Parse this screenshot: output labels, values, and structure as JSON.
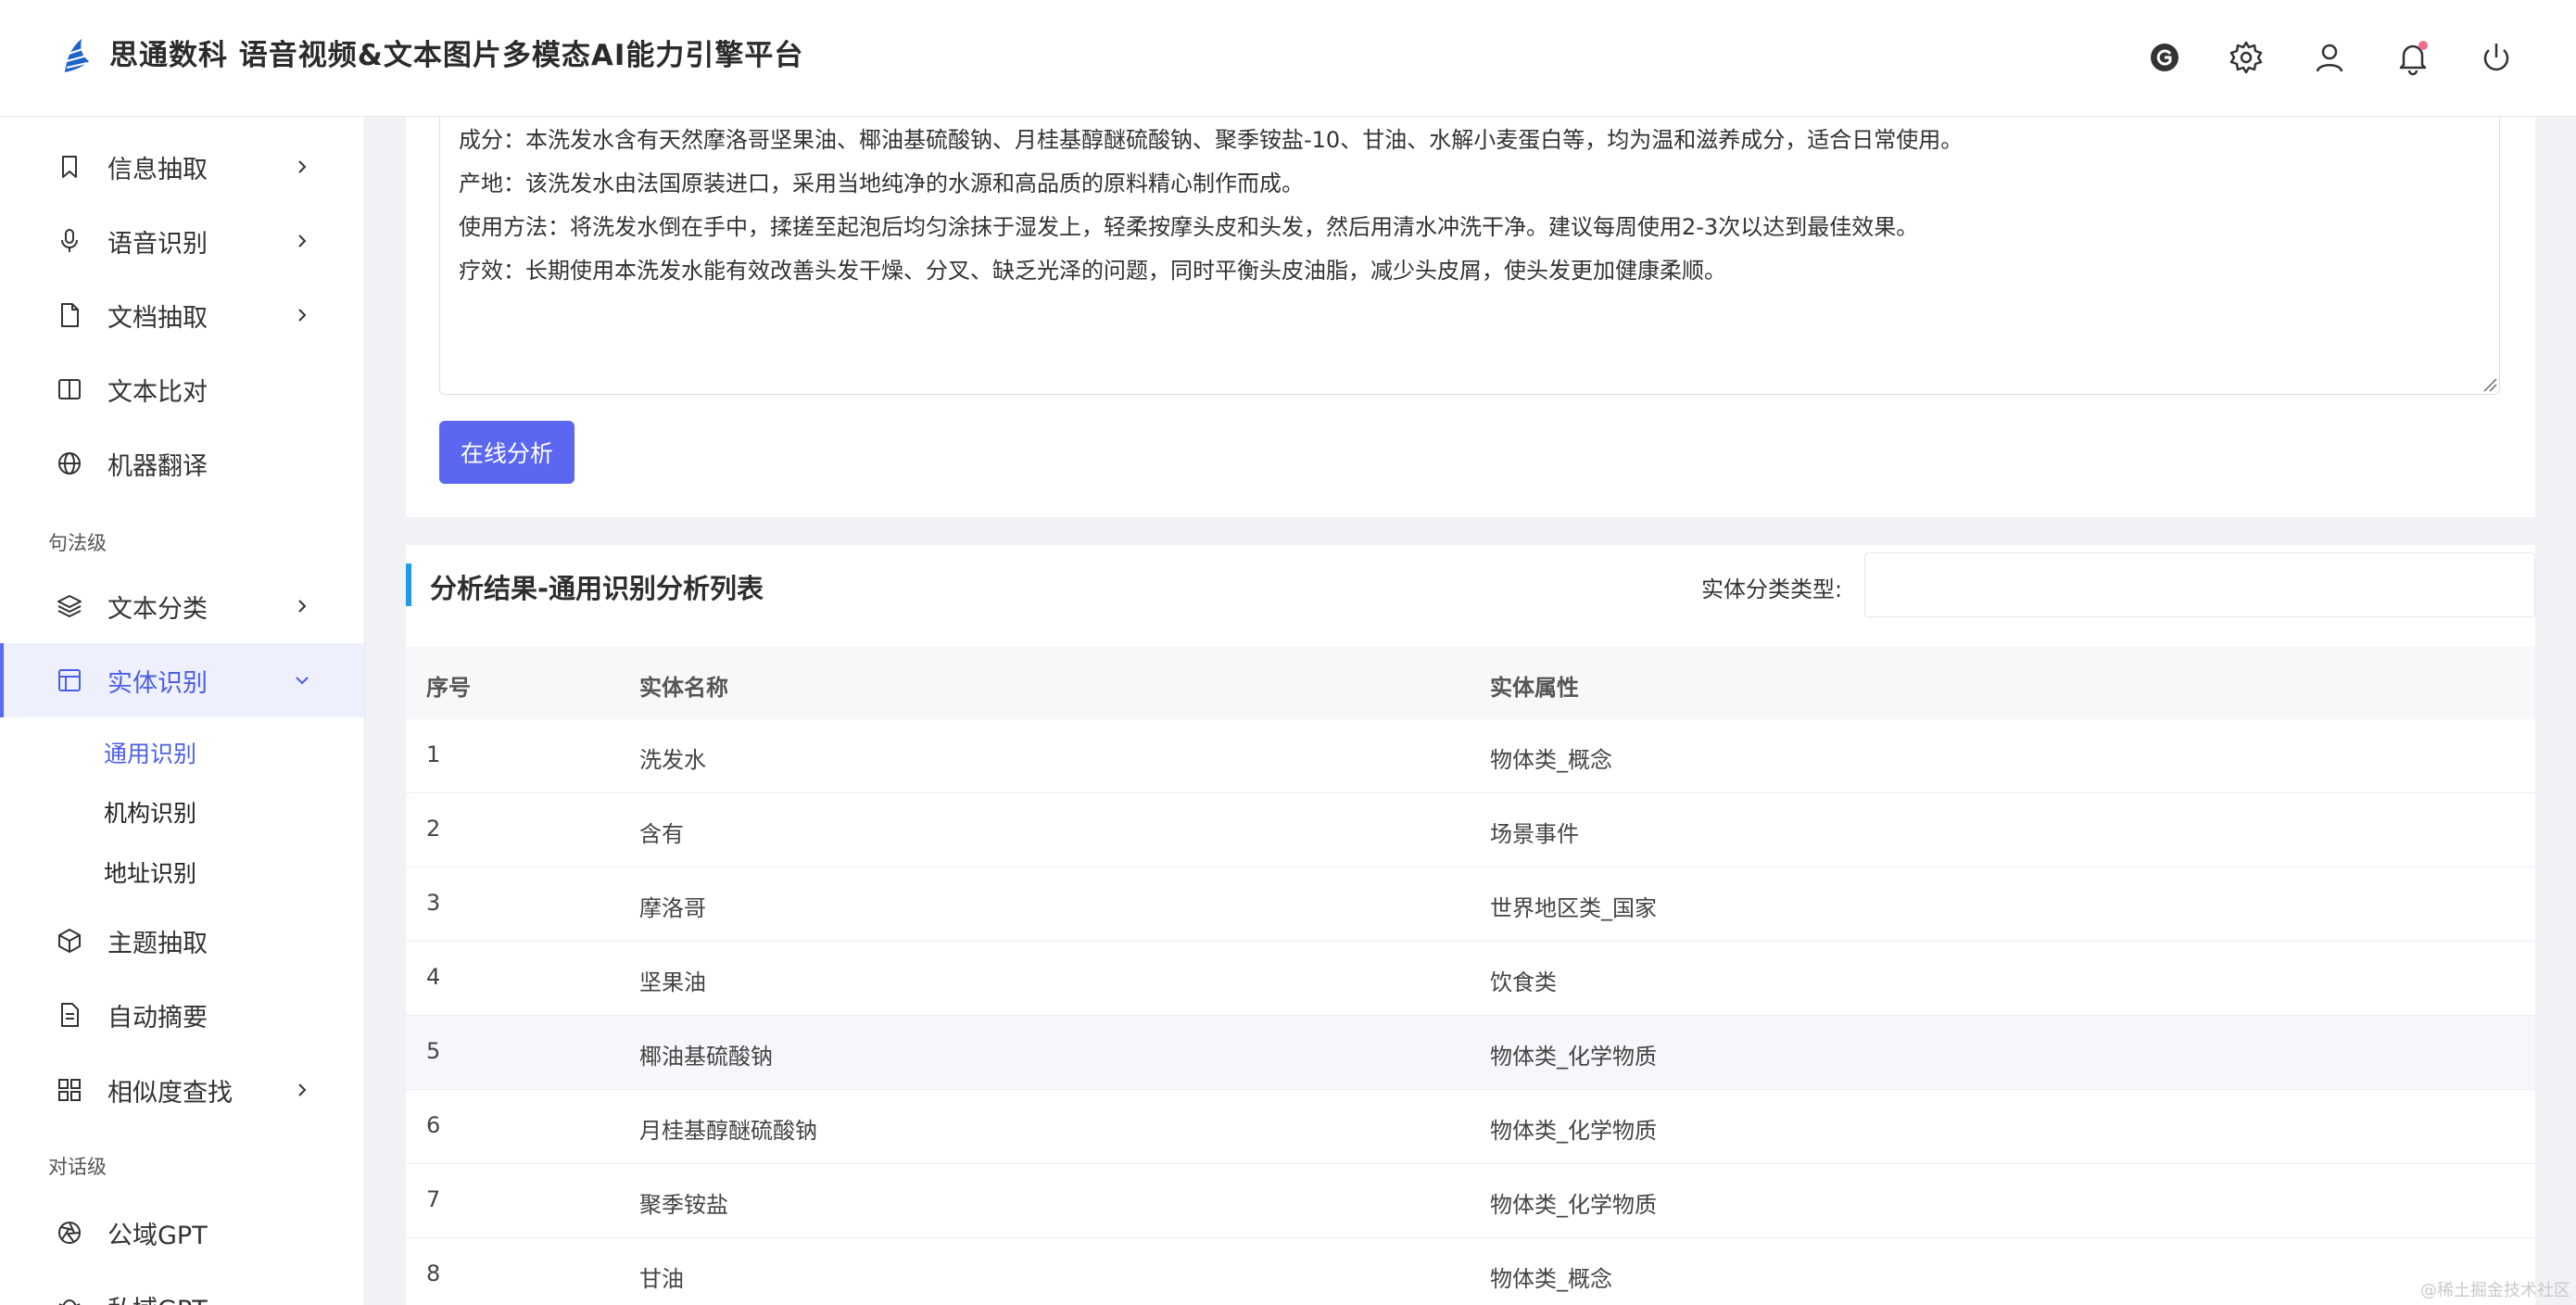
{
  "header": {
    "title": "思通数科 语音视频&文本图片多模态AI能力引擎平台",
    "icons": [
      "github-icon",
      "gear-icon",
      "user-icon",
      "bell-icon",
      "power-icon"
    ]
  },
  "sidebar": {
    "items": [
      {
        "label": "信息抽取",
        "icon": "bookmark-icon",
        "expandable": true
      },
      {
        "label": "语音识别",
        "icon": "microphone-icon",
        "expandable": true
      },
      {
        "label": "文档抽取",
        "icon": "document-icon",
        "expandable": true
      },
      {
        "label": "文本比对",
        "icon": "columns-icon",
        "expandable": false
      },
      {
        "label": "机器翻译",
        "icon": "globe-icon",
        "expandable": false
      },
      {
        "label": "文本分类",
        "icon": "layers-icon",
        "expandable": true
      },
      {
        "label": "实体识别",
        "icon": "layout-icon",
        "expandable": true,
        "active": true,
        "expanded": true
      },
      {
        "label": "主题抽取",
        "icon": "cube-icon",
        "expandable": false
      },
      {
        "label": "自动摘要",
        "icon": "file-text-icon",
        "expandable": false
      },
      {
        "label": "相似度查找",
        "icon": "grid-icon",
        "expandable": true
      },
      {
        "label": "公域GPT",
        "icon": "aperture-icon",
        "expandable": false
      },
      {
        "label": "私域GPT",
        "icon": "bug-icon",
        "expandable": false
      }
    ],
    "sections": [
      "句法级",
      "对话级"
    ],
    "subitems": [
      {
        "label": "通用识别",
        "active": true
      },
      {
        "label": "机构识别"
      },
      {
        "label": "地址识别"
      }
    ]
  },
  "input": {
    "lines": [
      "成分：本洗发水含有天然摩洛哥坚果油、椰油基硫酸钠、月桂基醇醚硫酸钠、聚季铵盐-10、甘油、水解小麦蛋白等，均为温和滋养成分，适合日常使用。",
      "产地：该洗发水由法国原装进口，采用当地纯净的水源和高品质的原料精心制作而成。",
      "使用方法：将洗发水倒在手中，揉搓至起泡后均匀涂抹于湿发上，轻柔按摩头皮和头发，然后用清水冲洗干净。建议每周使用2-3次以达到最佳效果。",
      "疗效：长期使用本洗发水能有效改善头发干燥、分叉、缺乏光泽的问题，同时平衡头皮油脂，减少头皮屑，使头发更加健康柔顺。"
    ],
    "analyze_button": "在线分析"
  },
  "results": {
    "title": "分析结果-通用识别分析列表",
    "filter_label": "实体分类类型:",
    "filter_value": "",
    "columns": [
      "序号",
      "实体名称",
      "实体属性"
    ],
    "rows": [
      [
        "1",
        "洗发水",
        "物体类_概念"
      ],
      [
        "2",
        "含有",
        "场景事件"
      ],
      [
        "3",
        "摩洛哥",
        "世界地区类_国家"
      ],
      [
        "4",
        "坚果油",
        "饮食类"
      ],
      [
        "5",
        "椰油基硫酸钠",
        "物体类_化学物质"
      ],
      [
        "6",
        "月桂基醇醚硫酸钠",
        "物体类_化学物质"
      ],
      [
        "7",
        "聚季铵盐",
        "物体类_化学物质"
      ],
      [
        "8",
        "甘油",
        "物体类_概念"
      ]
    ]
  },
  "watermark": "@稀土掘金技术社区",
  "colors": {
    "accent": "#5b67f1",
    "active_text": "#4c5ee8",
    "result_bar": "#1f9be8"
  }
}
